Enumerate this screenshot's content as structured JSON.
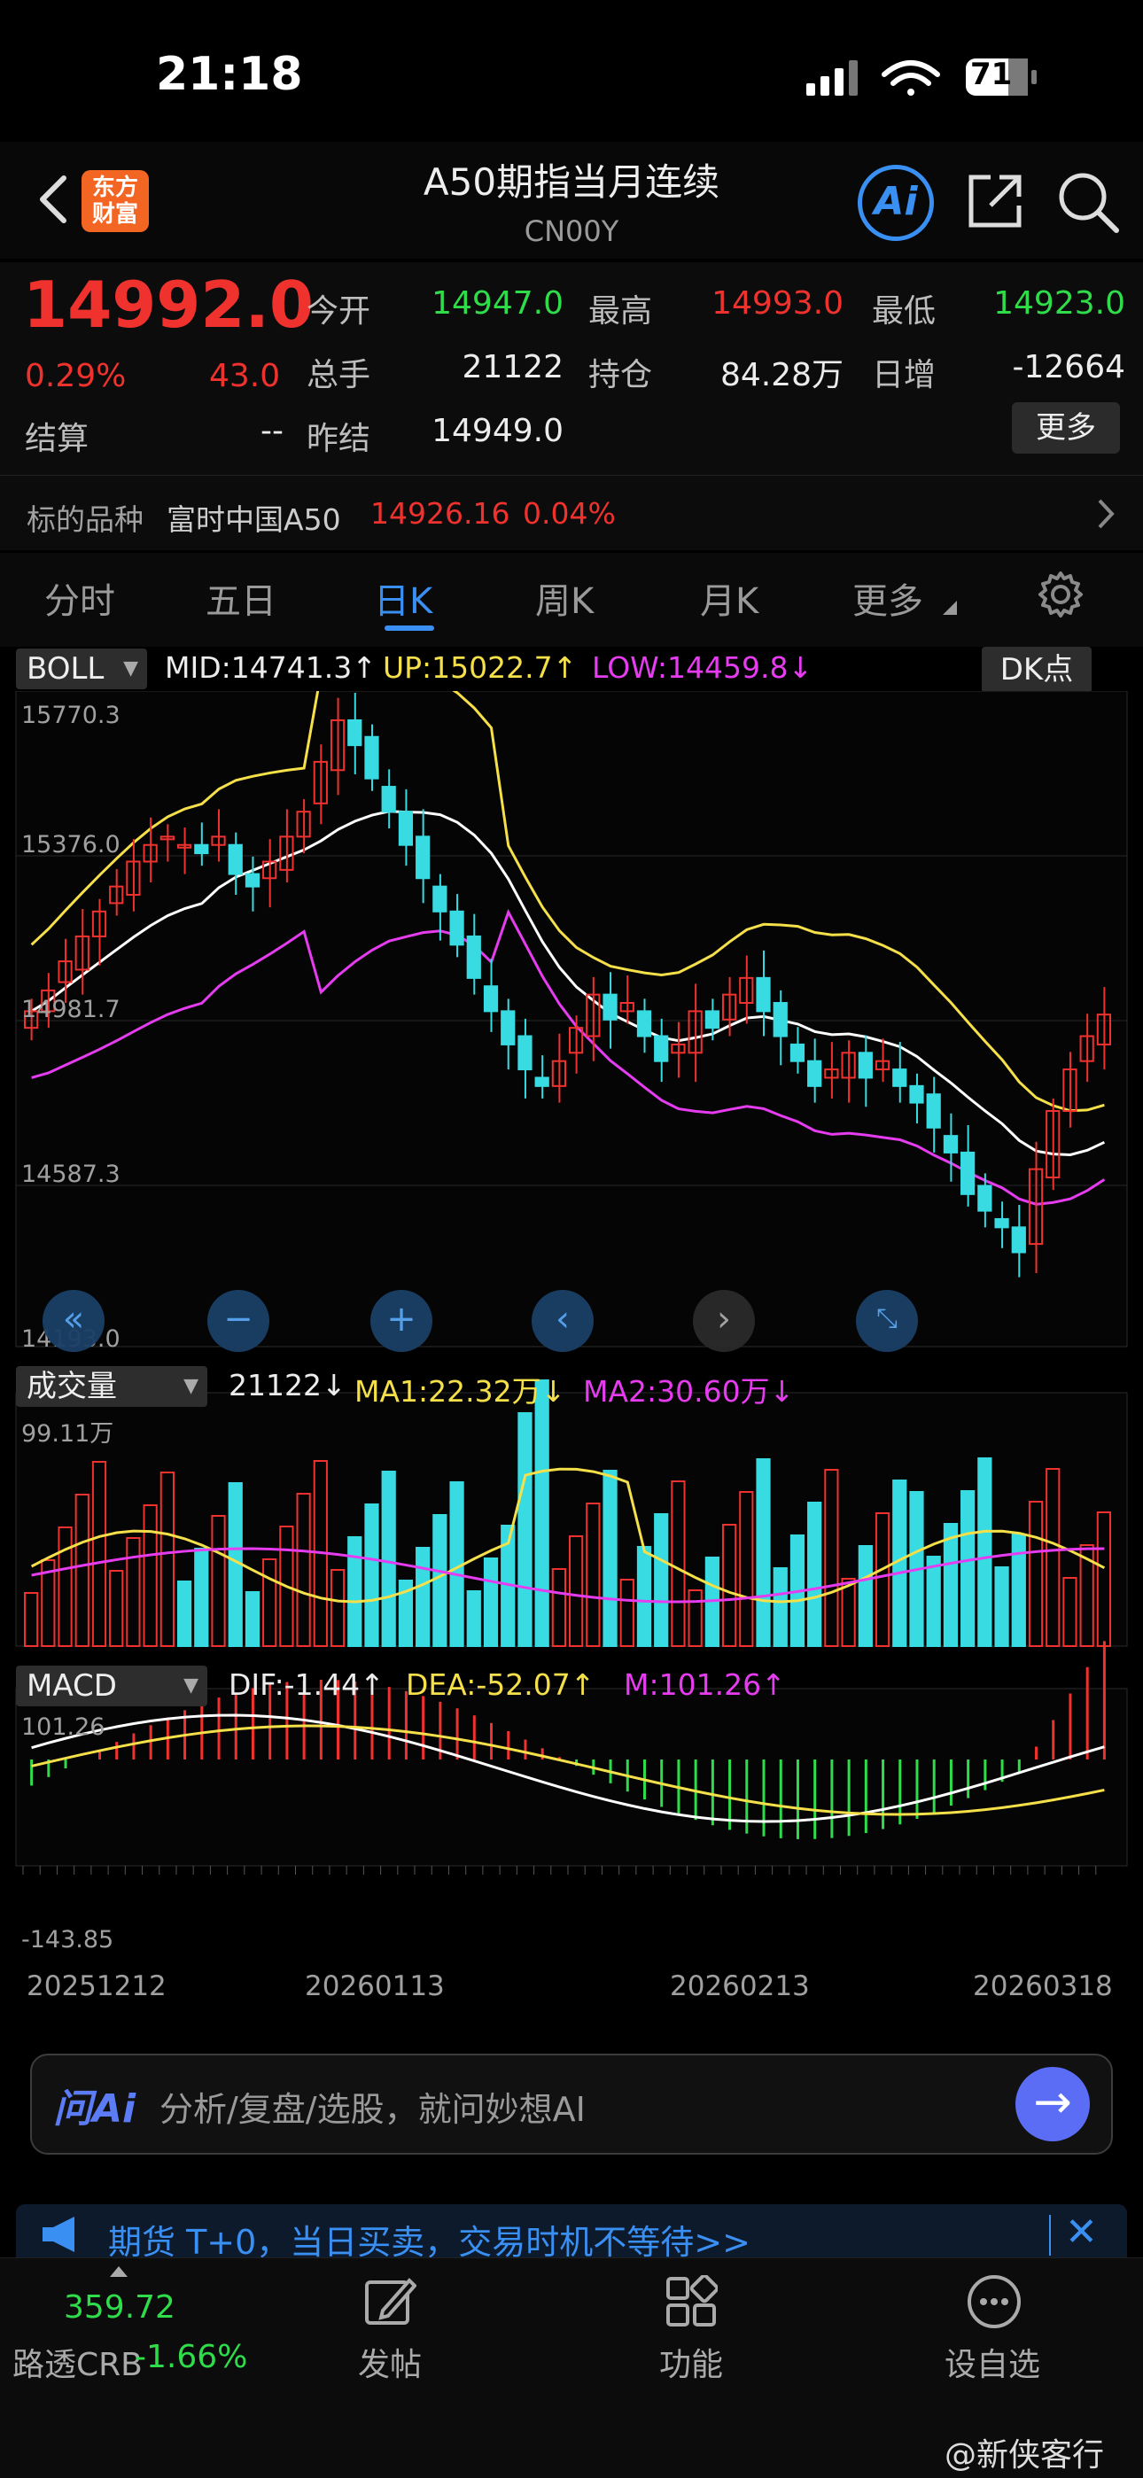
{
  "status": {
    "time": "21:18",
    "battery": "71"
  },
  "header": {
    "title": "A50期指当月连续",
    "subtitle": "CN00Y",
    "logo_line1": "东方",
    "logo_line2": "财富",
    "ai_label": "Ai"
  },
  "quote": {
    "last_price": "14992.0",
    "change_pct": "0.29%",
    "change_abs": "43.0",
    "rows": [
      {
        "l1": "今开",
        "v1": "14947.0",
        "l2": "最高",
        "v2": "14993.0",
        "l3": "最低",
        "v3": "14923.0"
      },
      {
        "l1": "总手",
        "v1": "21122",
        "l2": "持仓",
        "v2": "84.28万",
        "l3": "日增",
        "v3": "-12664"
      },
      {
        "l1": "结算",
        "v1": "--",
        "l2": "昨结",
        "v2": "14949.0"
      }
    ],
    "more_label": "更多",
    "underlying_label": "标的品种",
    "underlying_name": "富时中国A50",
    "underlying_price": "14926.16",
    "underlying_pct": "0.04%"
  },
  "tabs": [
    "分时",
    "五日",
    "日K",
    "周K",
    "月K",
    "更多"
  ],
  "active_tab": "日K",
  "boll": {
    "selector": "BOLL",
    "mid": "MID:14741.3↑",
    "up": "UP:15022.7↑",
    "low": "LOW:14459.8↓",
    "dk_label": "DK点",
    "y_labels": [
      "15770.3",
      "15376.0",
      "14981.7",
      "14587.3",
      "14193.0"
    ]
  },
  "volume": {
    "selector": "成交量",
    "value": "21122↓",
    "ma1": "MA1:22.32万↓",
    "ma2": "MA2:30.60万↓",
    "y_label": "99.11万"
  },
  "macd": {
    "selector": "MACD",
    "dif": "DIF:-1.44↑",
    "dea": "DEA:-52.07↑",
    "m": "M:101.26↑",
    "y_top": "101.26",
    "y_bottom": "-143.85",
    "dates": [
      "20251212",
      "20260113",
      "20260213",
      "20260318"
    ]
  },
  "colors": {
    "up": "#f0322e",
    "down": "#38dbe2",
    "mid": "#ffffff",
    "upper": "#f5e04a",
    "lower": "#e63cf0",
    "accent": "#3a8ff2"
  },
  "askai": {
    "logo": "问Ai",
    "placeholder": "分析/复盘/选股，就问妙想AI"
  },
  "banner": {
    "text": "期货 T+0，当日买卖，交易时机不等待>>"
  },
  "bottom_nav": {
    "crb_value": "359.72",
    "crb_label": "路透CRB",
    "crb_pct": "-1.66%",
    "post": "发帖",
    "functions": "功能",
    "watchlist": "设自选"
  },
  "watermark": "@新侠客行"
}
